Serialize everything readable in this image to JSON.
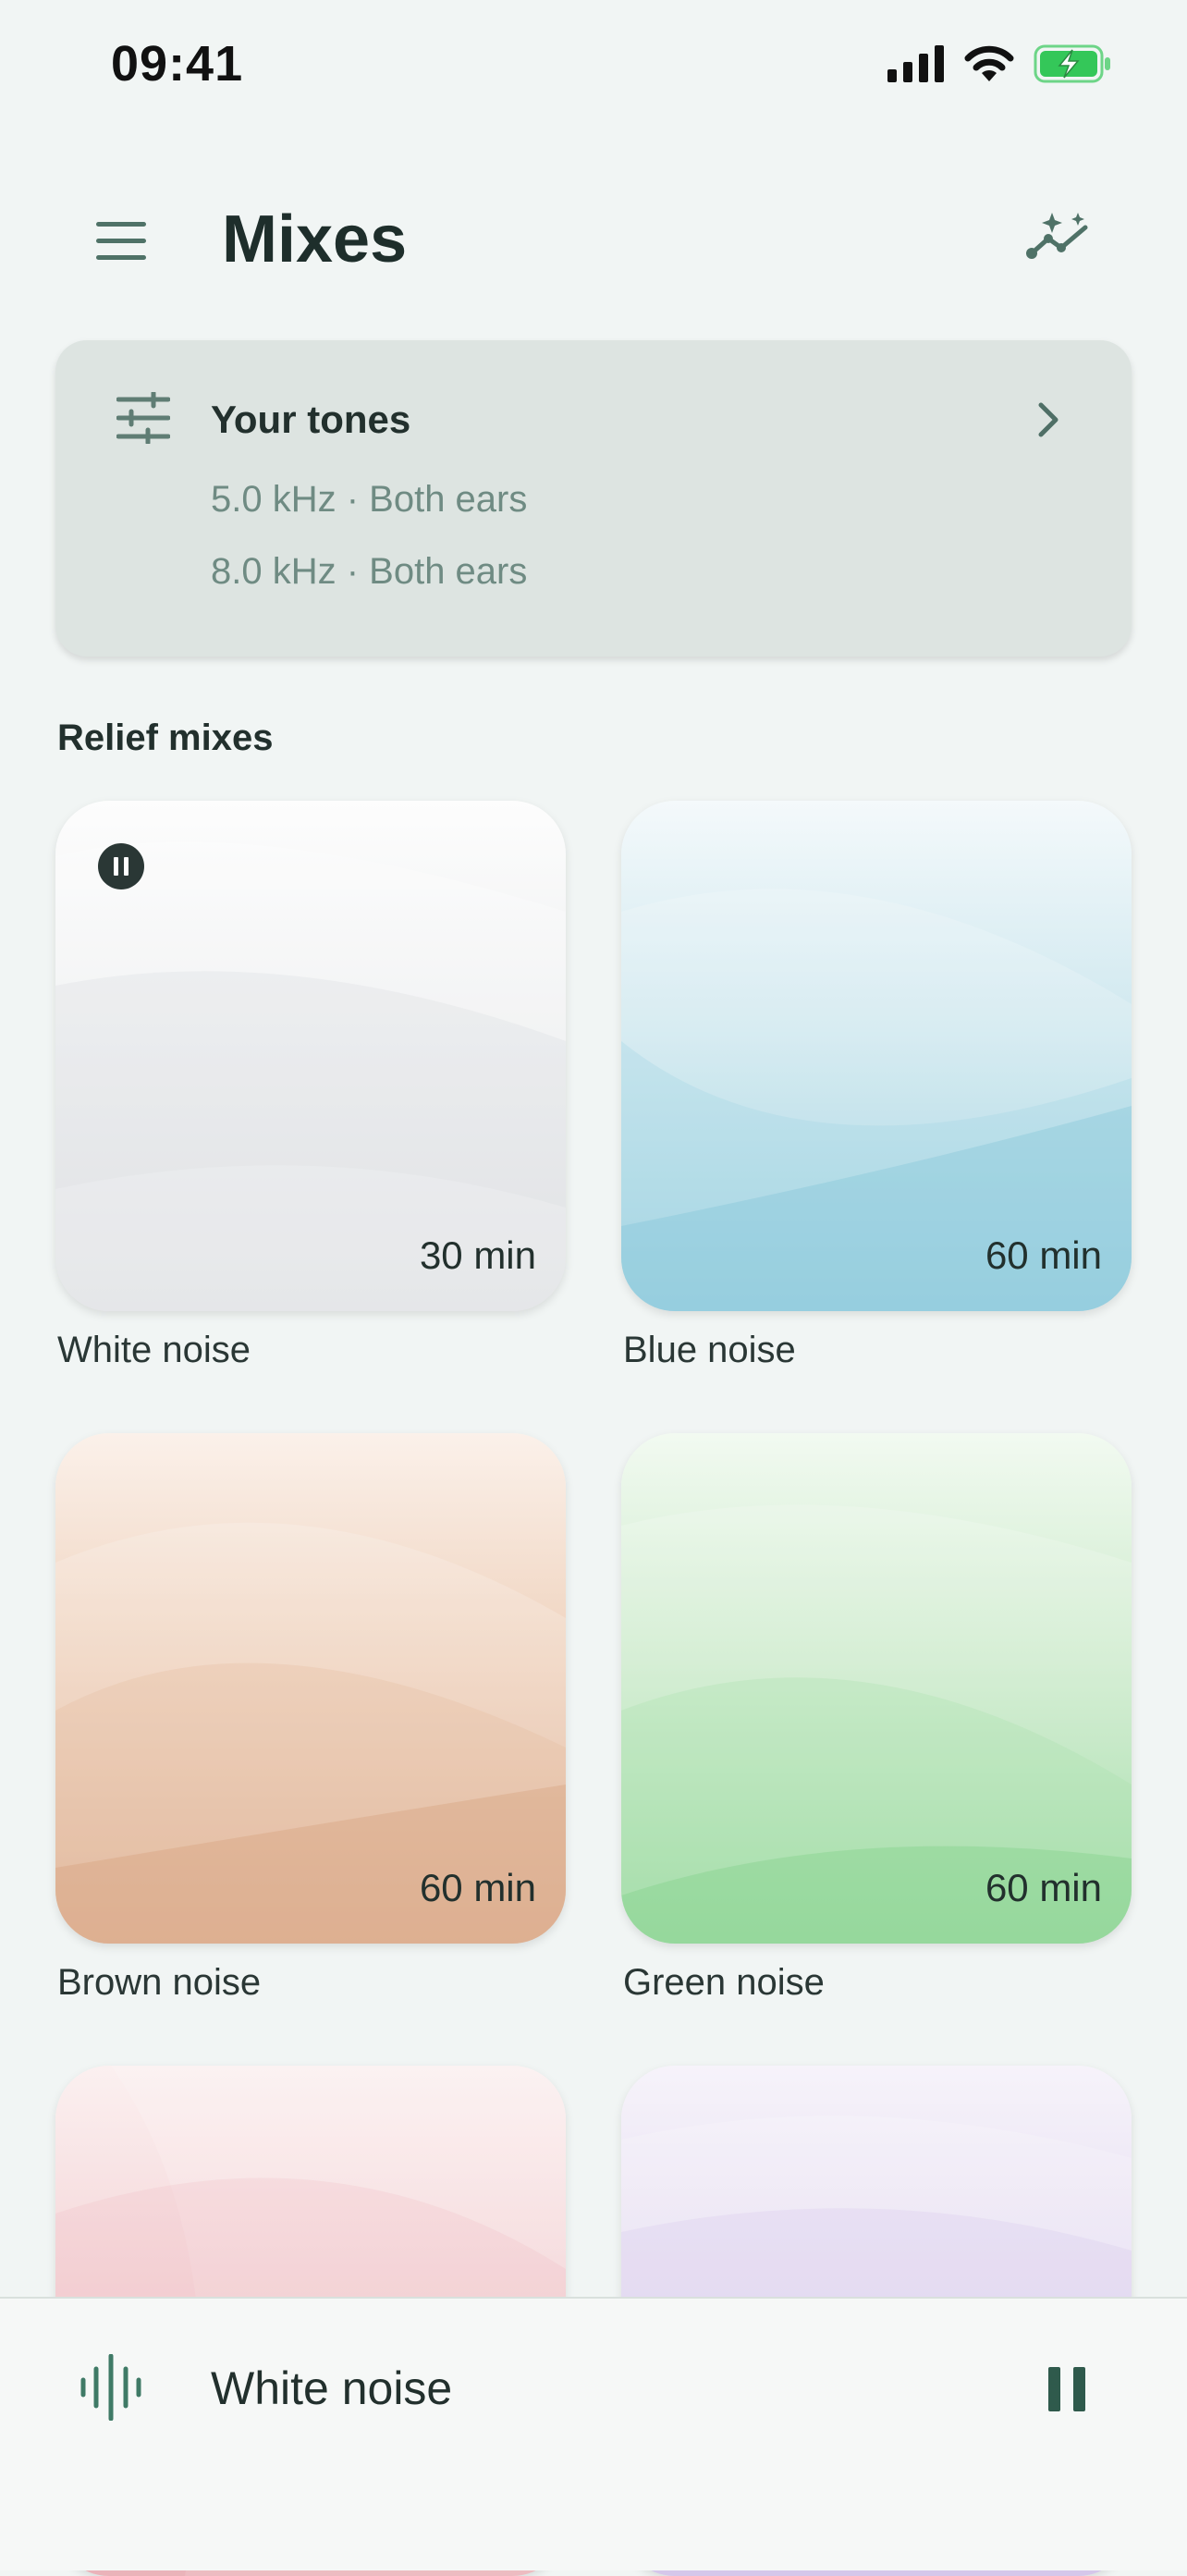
{
  "status_bar": {
    "time": "09:41"
  },
  "header": {
    "title": "Mixes"
  },
  "tones": {
    "title": "Your tones",
    "lines": [
      "5.0 kHz · Both ears",
      "8.0 kHz · Both ears"
    ]
  },
  "section": {
    "title": "Relief mixes"
  },
  "mixes": [
    {
      "name": "White noise",
      "duration": "30 min",
      "playing": true
    },
    {
      "name": "Blue noise",
      "duration": "60 min"
    },
    {
      "name": "Brown noise",
      "duration": "60 min"
    },
    {
      "name": "Green noise",
      "duration": "60 min"
    },
    {
      "name": "",
      "duration": ""
    },
    {
      "name": "",
      "duration": ""
    }
  ],
  "player": {
    "title": "White noise"
  },
  "icons": {
    "menu": "menu-icon",
    "insights": "sparkle-chart-icon",
    "tones": "sliders-icon",
    "chevron": "chevron-right-icon",
    "pause": "pause-icon",
    "waveform": "waveform-icon"
  },
  "colors": {
    "background": "#f1f5f4",
    "accent": "#2f5a4c",
    "card": "#dde4e1",
    "battery": "#34c759"
  }
}
